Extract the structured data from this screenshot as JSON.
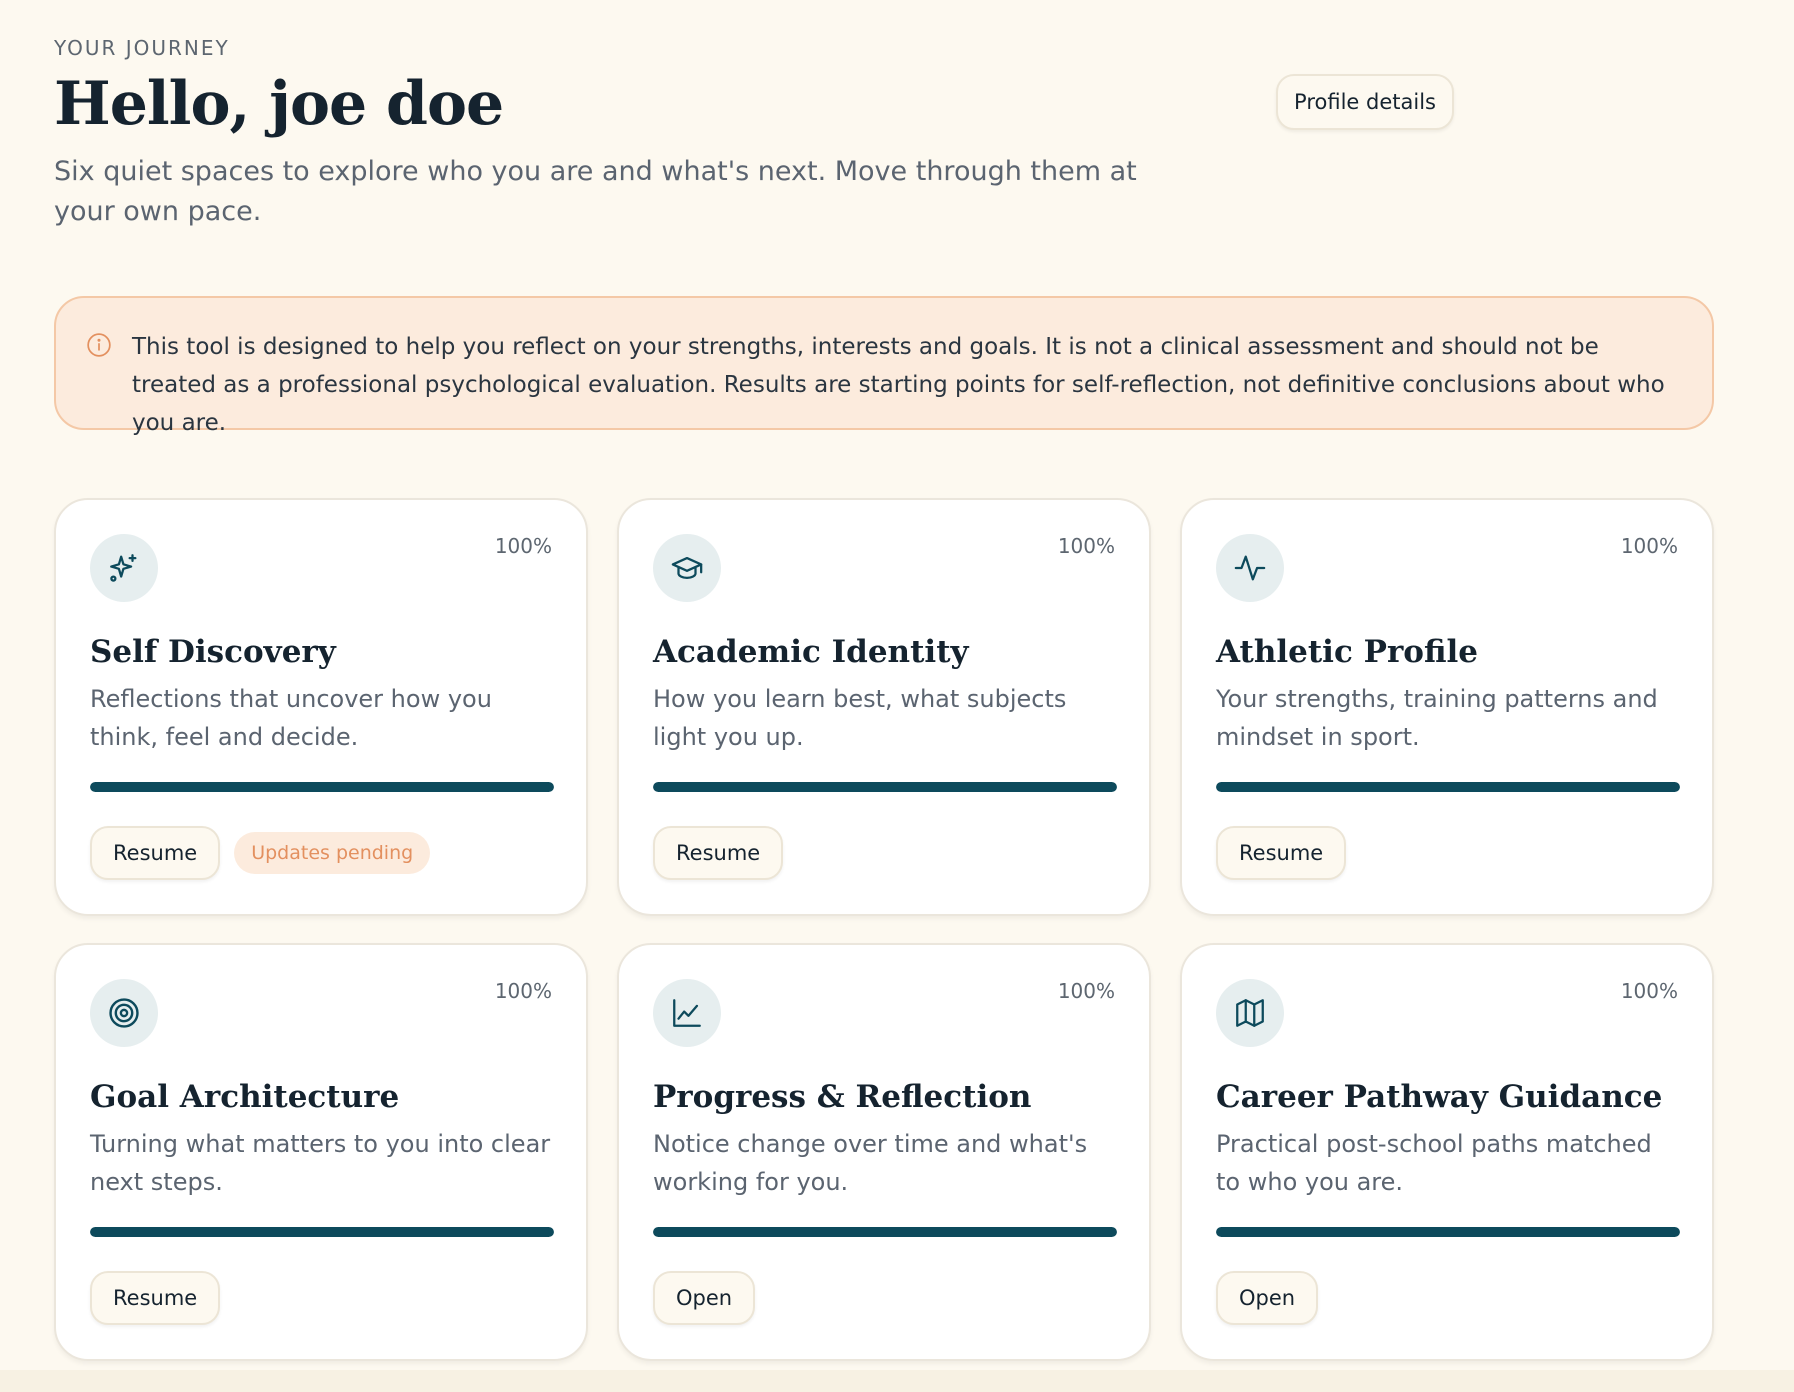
{
  "header": {
    "eyebrow": "YOUR JOURNEY",
    "greeting": "Hello, joe doe",
    "subtitle": "Six quiet spaces to explore who you are and what's next. Move through them at your own pace.",
    "profile_button": "Profile details"
  },
  "notice": {
    "icon": "info-icon",
    "text": "This tool is designed to help you reflect on your strengths, interests and goals. It is not a clinical assessment and should not be treated as a professional psychological evaluation. Results are starting points for self-reflection, not definitive conclusions about who you are."
  },
  "colors": {
    "background": "#fdf9f0",
    "accent": "#0d4a5c",
    "notice_bg": "#fcebdd",
    "notice_border": "#f4c8a6",
    "badge_text": "#e3905f"
  },
  "cards": [
    {
      "icon": "sparkles-icon",
      "title": "Self Discovery",
      "description": "Reflections that uncover how you think, feel and decide.",
      "progress_label": "100%",
      "progress": 1.0,
      "action": "Resume",
      "badge": "Updates pending"
    },
    {
      "icon": "graduation-cap-icon",
      "title": "Academic Identity",
      "description": "How you learn best, what subjects light you up.",
      "progress_label": "100%",
      "progress": 1.0,
      "action": "Resume"
    },
    {
      "icon": "activity-icon",
      "title": "Athletic Profile",
      "description": "Your strengths, training patterns and mindset in sport.",
      "progress_label": "100%",
      "progress": 1.0,
      "action": "Resume"
    },
    {
      "icon": "target-icon",
      "title": "Goal Architecture",
      "description": "Turning what matters to you into clear next steps.",
      "progress_label": "100%",
      "progress": 1.0,
      "action": "Resume"
    },
    {
      "icon": "line-chart-icon",
      "title": "Progress & Reflection",
      "description": "Notice change over time and what's working for you.",
      "progress_label": "100%",
      "progress": 1.0,
      "action": "Open"
    },
    {
      "icon": "map-icon",
      "title": "Career Pathway Guidance",
      "description": "Practical post-school paths matched to who you are.",
      "progress_label": "100%",
      "progress": 1.0,
      "action": "Open"
    }
  ]
}
